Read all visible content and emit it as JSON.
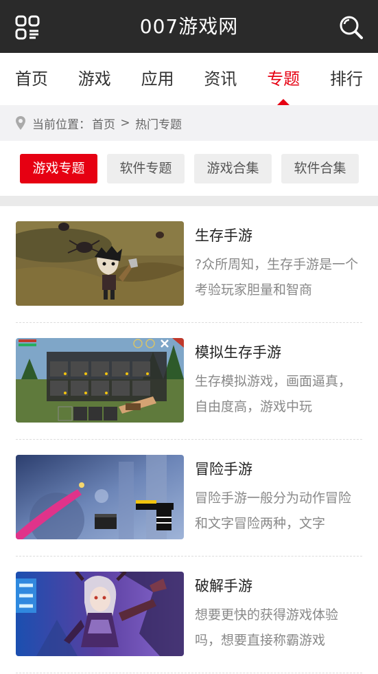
{
  "header": {
    "title": "007游戏网",
    "menu_icon": "apps-menu-icon",
    "search_icon": "search-icon"
  },
  "nav": {
    "items": [
      {
        "label": "首页"
      },
      {
        "label": "游戏"
      },
      {
        "label": "应用"
      },
      {
        "label": "资讯"
      },
      {
        "label": "专题",
        "active": true
      },
      {
        "label": "排行"
      }
    ]
  },
  "breadcrumb": {
    "prefix": "当前位置：",
    "home": "首页",
    "sep": " > ",
    "current": "热门专题"
  },
  "categories": [
    {
      "label": "游戏专题",
      "active": true
    },
    {
      "label": "软件专题"
    },
    {
      "label": "游戏合集"
    },
    {
      "label": "软件合集"
    }
  ],
  "topics": [
    {
      "name": "生存手游",
      "desc": "?众所周知，生存手游是一个考验玩家胆量和智商"
    },
    {
      "name": "模拟生存手游",
      "desc": "生存模拟游戏，画面逼真，自由度高，游戏中玩"
    },
    {
      "name": "冒险手游",
      "desc": "冒险手游一般分为动作冒险和文字冒险两种，文字"
    },
    {
      "name": "破解手游",
      "desc": "想要更快的获得游戏体验吗，想要直接称霸游戏"
    }
  ],
  "colors": {
    "accent": "#e60012",
    "header_bg": "#2a2a2a"
  }
}
